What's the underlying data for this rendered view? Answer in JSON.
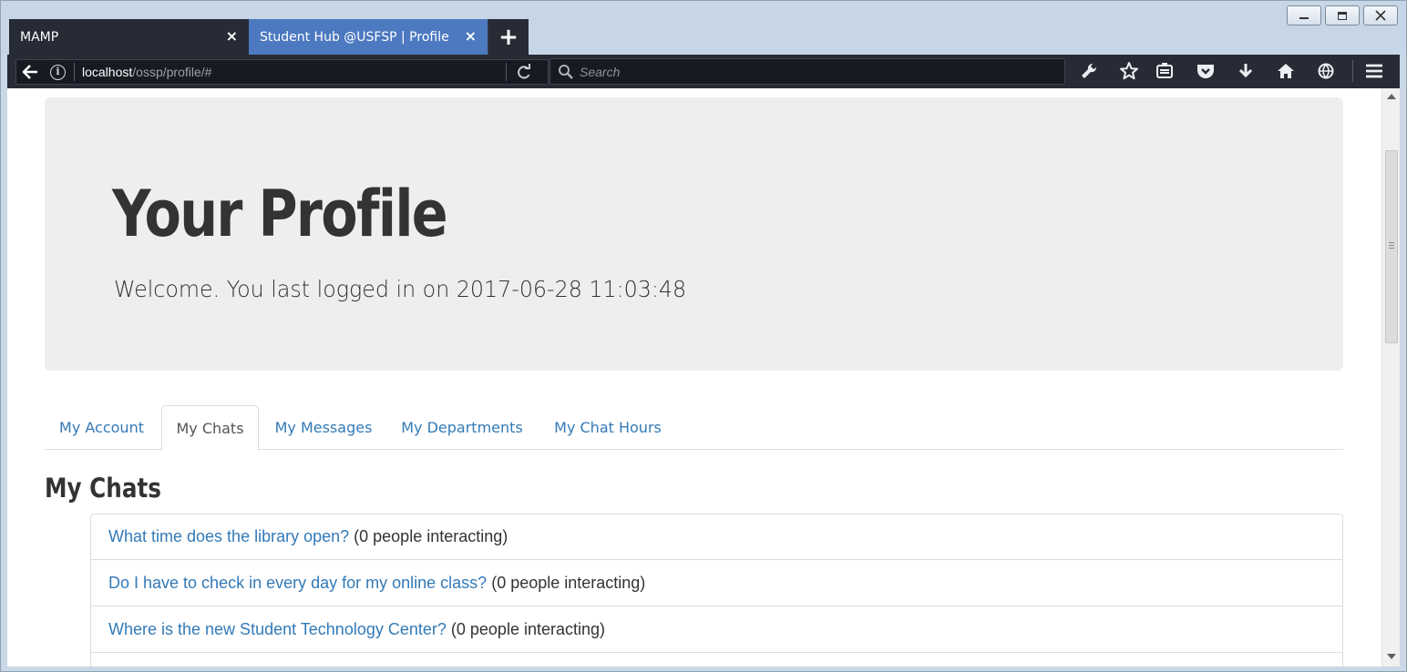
{
  "browser": {
    "tabs": [
      {
        "label": "MAMP",
        "active": false
      },
      {
        "label": "Student Hub @USFSP | Profile",
        "active": true
      }
    ],
    "tab_close_glyph": "×",
    "new_tab_glyph": "+",
    "url_host": "localhost",
    "url_path": "/ossp/profile/#",
    "search_placeholder": "Search",
    "toolbar_icons": [
      "wrench-icon",
      "star-icon",
      "reader-icon",
      "pocket-icon",
      "download-icon",
      "home-icon",
      "globe-icon",
      "menu-icon"
    ],
    "chrome_color": "#272b35",
    "active_tab_color": "#4c79c0"
  },
  "page": {
    "jumbotron": {
      "title": "Your Profile",
      "subtitle": "Welcome. You last logged in on 2017-06-28 11:03:48"
    },
    "tabs": [
      {
        "label": "My Account",
        "active": false
      },
      {
        "label": "My Chats",
        "active": true
      },
      {
        "label": "My Messages",
        "active": false
      },
      {
        "label": "My Departments",
        "active": false
      },
      {
        "label": "My Chat Hours",
        "active": false
      }
    ],
    "section_title": "My Chats",
    "chats": [
      {
        "question": "What time does the library open?",
        "count": "(0 people interacting)"
      },
      {
        "question": "Do I have to check in every day for my online class?",
        "count": "(0 people interacting)"
      },
      {
        "question": "Where is the new Student Technology Center?",
        "count": "(0 people interacting)"
      }
    ],
    "link_color": "#337ab7",
    "jumbotron_bg": "#eeeeee"
  }
}
